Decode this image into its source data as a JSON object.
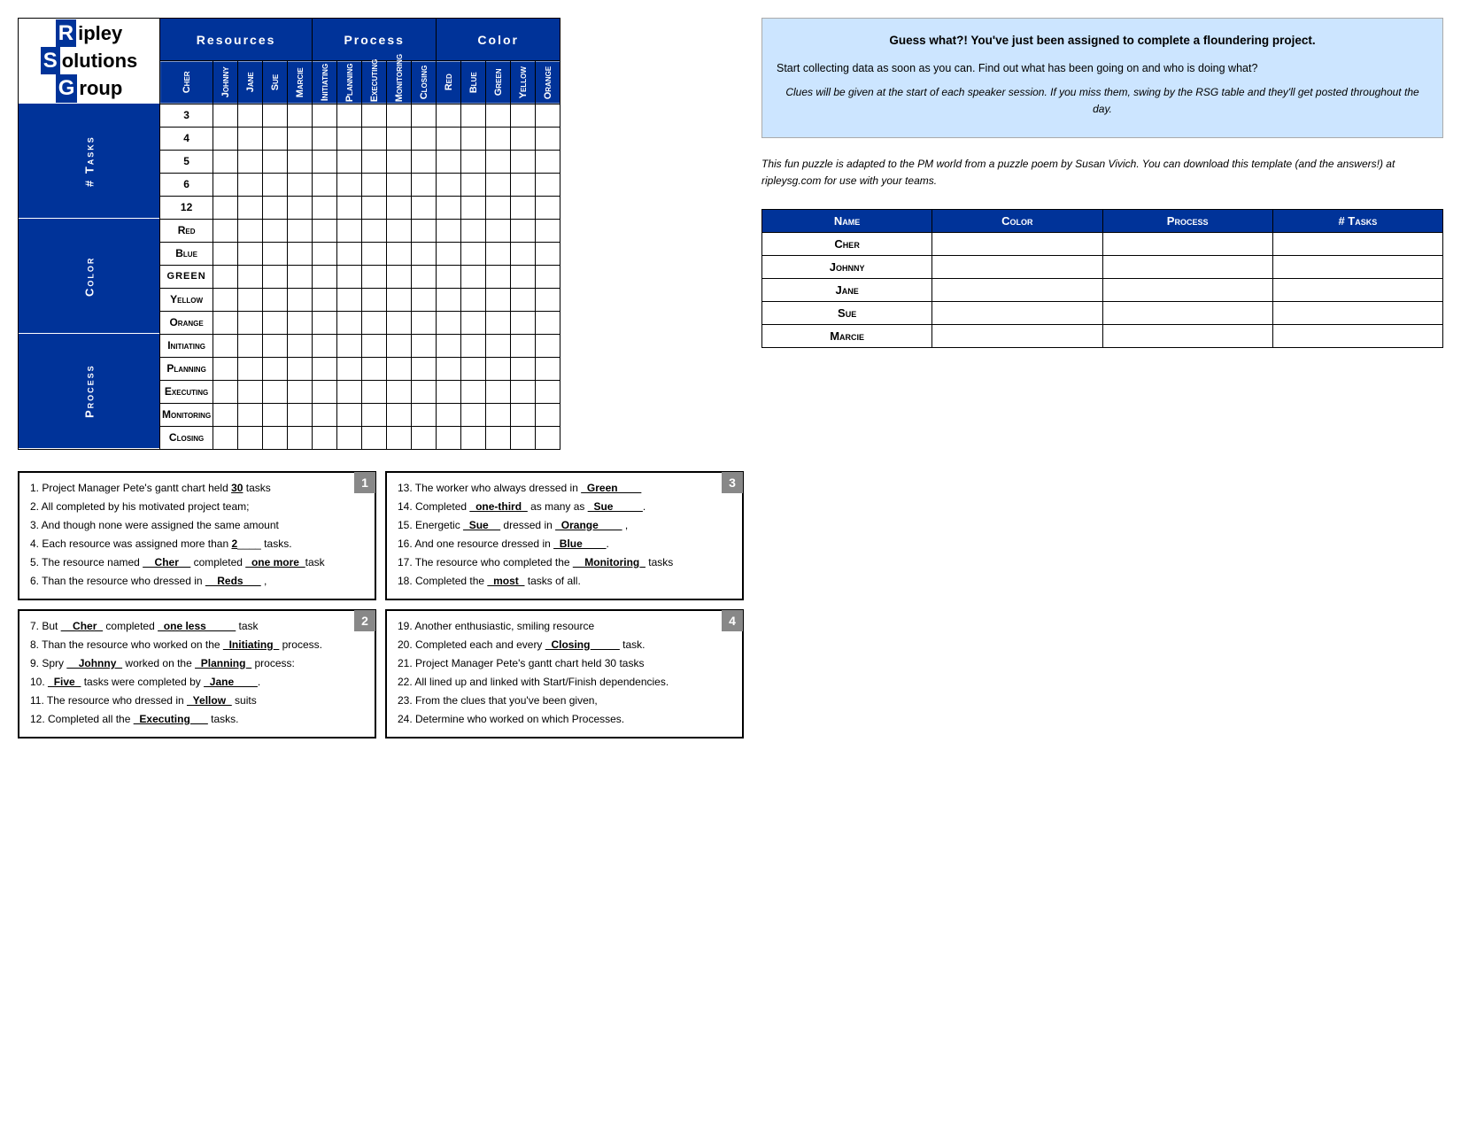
{
  "logo": {
    "line1": "ipley",
    "line2": "olutions",
    "line3": "roup",
    "r": "R",
    "s": "S",
    "g": "G"
  },
  "headers": {
    "resources": "Resources",
    "process": "Process",
    "color": "Color"
  },
  "col_headers": [
    "Cher",
    "Johnny",
    "Jane",
    "Sue",
    "Marcie",
    "Initiating",
    "Planning",
    "Executing",
    "Monitoring",
    "Closing",
    "Red",
    "Blue",
    "Green",
    "Yellow",
    "Orange"
  ],
  "row_groups": [
    {
      "group_label": "# Tasks",
      "rows": [
        "3",
        "4",
        "5",
        "6",
        "12"
      ]
    },
    {
      "group_label": "Color",
      "rows": [
        "Red",
        "Blue",
        "Green",
        "Yellow",
        "Orange"
      ]
    },
    {
      "group_label": "Process",
      "rows": [
        "Initiating",
        "Planning",
        "Executing",
        "Monitoring",
        "Closing"
      ]
    }
  ],
  "summary_table": {
    "headers": [
      "Name",
      "Color",
      "Process",
      "# Tasks"
    ],
    "rows": [
      {
        "name": "Cher"
      },
      {
        "name": "Johnny"
      },
      {
        "name": "Jane"
      },
      {
        "name": "Sue"
      },
      {
        "name": "Marcie"
      }
    ]
  },
  "info_box": {
    "title": "Guess what?! You've just been assigned to complete a floundering project.",
    "para1": "Start collecting data as soon as you can.  Find out what has been going on and who is doing what?",
    "para2": "Clues will be given at the start of each speaker session.  If you miss them, swing by the RSG table and they'll get posted throughout the day.",
    "para3": "This fun puzzle is adapted to the PM world from a puzzle poem by Susan Vivich.  You can download this template (and the answers!) at ripleysg.com for use with your teams."
  },
  "clues": {
    "box1": {
      "number": "1",
      "items": [
        "1.  Project Manager Pete's gantt chart held __30__ tasks",
        "2.  All completed by his motivated project team;",
        "3.  And though none were assigned the same amount",
        "4.  Each resource was assigned more than __2____ tasks.",
        "5.  The resource named __Cher__ completed _one more_task",
        "6.  Than the resource who dressed in __Reds___ ,"
      ]
    },
    "box2": {
      "number": "2",
      "items": [
        "7.  But __Cher_ completed _one less_____ task",
        "8.  Than the resource who worked on the _Initiating_ process.",
        "9.  Spry __Johnny_ worked on the _Planning_ process:",
        "10. _Five_ tasks were completed by _Jane____.",
        "11. The resource who dressed in _Yellow_ suits",
        "12. Completed all the _Executing___ tasks."
      ]
    },
    "box3": {
      "number": "3",
      "items": [
        "13. The worker who always dressed in _Green____",
        "14. Completed _one-third_ as many as _Sue_____.",
        "15. Energetic _Sue__ dressed in _Orange____ ,",
        "16. And one resource dressed in _Blue____.",
        "17. The resource who completed the __Monitoring_ tasks",
        "18. Completed the _most_ tasks of all."
      ]
    },
    "box4": {
      "number": "4",
      "items": [
        "19. Another enthusiastic, smiling resource",
        "20. Completed each and every _Closing____ task.",
        "21. Project Manager Pete's gantt chart held 30 tasks",
        "22. All lined up and linked with Start/Finish dependencies.",
        "23. From the clues that you've been given,",
        "24. Determine who worked on which Processes."
      ]
    }
  }
}
